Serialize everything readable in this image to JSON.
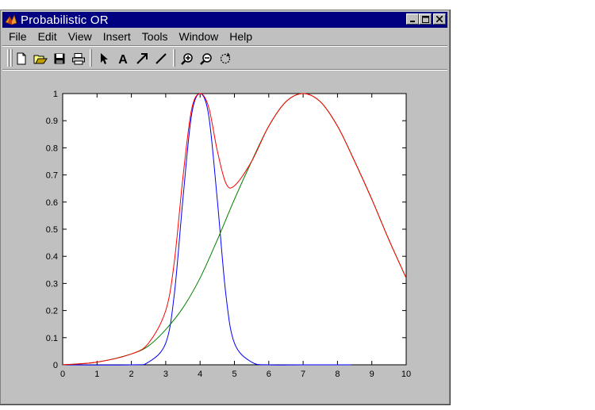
{
  "window": {
    "title": "Probabilistic OR",
    "controls": [
      "minimize",
      "maximize",
      "close"
    ]
  },
  "menu": {
    "items": [
      "File",
      "Edit",
      "View",
      "Insert",
      "Tools",
      "Window",
      "Help"
    ]
  },
  "toolbar": {
    "tools": [
      "new-file-icon",
      "open-folder-icon",
      "save-icon",
      "print-icon",
      "select-arrow-icon",
      "insert-text-icon",
      "insert-arrow-icon",
      "insert-line-icon",
      "zoom-in-icon",
      "zoom-out-icon",
      "rotate-icon"
    ],
    "text_tool_glyph": "A"
  },
  "chart_data": {
    "type": "line",
    "xlim": [
      0,
      10
    ],
    "ylim": [
      0,
      1
    ],
    "x_ticks": [
      "0",
      "1",
      "2",
      "3",
      "4",
      "5",
      "6",
      "7",
      "8",
      "9",
      "10"
    ],
    "y_ticks": [
      "0",
      "0.1",
      "0.2",
      "0.3",
      "0.4",
      "0.5",
      "0.6",
      "0.7",
      "0.8",
      "0.9",
      "1"
    ],
    "grid": false,
    "series": [
      {
        "color": "#0000ff",
        "x": [
          0,
          2.0,
          2.5,
          3.0,
          3.25,
          3.5,
          3.75,
          4.0,
          4.25,
          4.5,
          4.75,
          5.0,
          5.5,
          6.0,
          7.0,
          8.4
        ],
        "y": [
          0,
          0.0,
          0.01,
          0.08,
          0.26,
          0.61,
          0.92,
          1.0,
          0.92,
          0.61,
          0.26,
          0.08,
          0.01,
          0.0,
          0.0,
          0.0
        ]
      },
      {
        "color": "#008000",
        "x": [
          0,
          1.0,
          2.0,
          2.5,
          3.0,
          3.5,
          4.0,
          4.5,
          5.0,
          5.5,
          6.0,
          6.5,
          7.0,
          7.5,
          8.0,
          8.5,
          9.0,
          9.5,
          10.0
        ],
        "y": [
          0.0,
          0.01,
          0.04,
          0.07,
          0.13,
          0.21,
          0.32,
          0.46,
          0.61,
          0.75,
          0.88,
          0.97,
          1.0,
          0.97,
          0.88,
          0.75,
          0.61,
          0.46,
          0.32
        ]
      },
      {
        "color": "#ff0000",
        "x": [
          0,
          1.0,
          2.0,
          2.5,
          3.0,
          3.25,
          3.5,
          3.75,
          4.0,
          4.25,
          4.5,
          4.75,
          5.0,
          5.5,
          6.0,
          6.5,
          7.0,
          7.5,
          8.0,
          8.5,
          9.0,
          9.5,
          10.0
        ],
        "y": [
          0.0,
          0.01,
          0.04,
          0.08,
          0.2,
          0.38,
          0.69,
          0.94,
          1.0,
          0.95,
          0.79,
          0.67,
          0.66,
          0.75,
          0.88,
          0.97,
          1.0,
          0.97,
          0.88,
          0.75,
          0.61,
          0.46,
          0.32
        ]
      }
    ]
  }
}
